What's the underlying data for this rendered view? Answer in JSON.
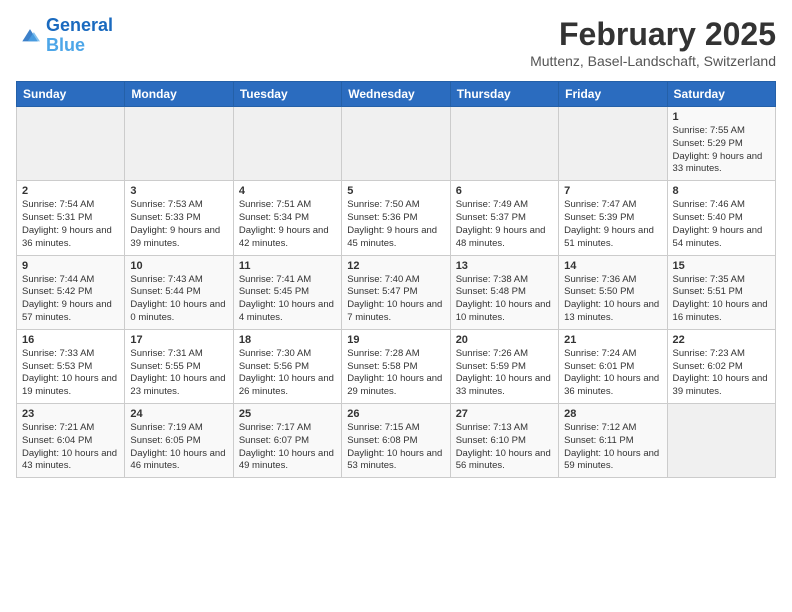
{
  "header": {
    "logo_line1": "General",
    "logo_line2": "Blue",
    "month_title": "February 2025",
    "location": "Muttenz, Basel-Landschaft, Switzerland"
  },
  "weekdays": [
    "Sunday",
    "Monday",
    "Tuesday",
    "Wednesday",
    "Thursday",
    "Friday",
    "Saturday"
  ],
  "weeks": [
    [
      {
        "day": "",
        "info": ""
      },
      {
        "day": "",
        "info": ""
      },
      {
        "day": "",
        "info": ""
      },
      {
        "day": "",
        "info": ""
      },
      {
        "day": "",
        "info": ""
      },
      {
        "day": "",
        "info": ""
      },
      {
        "day": "1",
        "info": "Sunrise: 7:55 AM\nSunset: 5:29 PM\nDaylight: 9 hours and 33 minutes."
      }
    ],
    [
      {
        "day": "2",
        "info": "Sunrise: 7:54 AM\nSunset: 5:31 PM\nDaylight: 9 hours and 36 minutes."
      },
      {
        "day": "3",
        "info": "Sunrise: 7:53 AM\nSunset: 5:33 PM\nDaylight: 9 hours and 39 minutes."
      },
      {
        "day": "4",
        "info": "Sunrise: 7:51 AM\nSunset: 5:34 PM\nDaylight: 9 hours and 42 minutes."
      },
      {
        "day": "5",
        "info": "Sunrise: 7:50 AM\nSunset: 5:36 PM\nDaylight: 9 hours and 45 minutes."
      },
      {
        "day": "6",
        "info": "Sunrise: 7:49 AM\nSunset: 5:37 PM\nDaylight: 9 hours and 48 minutes."
      },
      {
        "day": "7",
        "info": "Sunrise: 7:47 AM\nSunset: 5:39 PM\nDaylight: 9 hours and 51 minutes."
      },
      {
        "day": "8",
        "info": "Sunrise: 7:46 AM\nSunset: 5:40 PM\nDaylight: 9 hours and 54 minutes."
      }
    ],
    [
      {
        "day": "9",
        "info": "Sunrise: 7:44 AM\nSunset: 5:42 PM\nDaylight: 9 hours and 57 minutes."
      },
      {
        "day": "10",
        "info": "Sunrise: 7:43 AM\nSunset: 5:44 PM\nDaylight: 10 hours and 0 minutes."
      },
      {
        "day": "11",
        "info": "Sunrise: 7:41 AM\nSunset: 5:45 PM\nDaylight: 10 hours and 4 minutes."
      },
      {
        "day": "12",
        "info": "Sunrise: 7:40 AM\nSunset: 5:47 PM\nDaylight: 10 hours and 7 minutes."
      },
      {
        "day": "13",
        "info": "Sunrise: 7:38 AM\nSunset: 5:48 PM\nDaylight: 10 hours and 10 minutes."
      },
      {
        "day": "14",
        "info": "Sunrise: 7:36 AM\nSunset: 5:50 PM\nDaylight: 10 hours and 13 minutes."
      },
      {
        "day": "15",
        "info": "Sunrise: 7:35 AM\nSunset: 5:51 PM\nDaylight: 10 hours and 16 minutes."
      }
    ],
    [
      {
        "day": "16",
        "info": "Sunrise: 7:33 AM\nSunset: 5:53 PM\nDaylight: 10 hours and 19 minutes."
      },
      {
        "day": "17",
        "info": "Sunrise: 7:31 AM\nSunset: 5:55 PM\nDaylight: 10 hours and 23 minutes."
      },
      {
        "day": "18",
        "info": "Sunrise: 7:30 AM\nSunset: 5:56 PM\nDaylight: 10 hours and 26 minutes."
      },
      {
        "day": "19",
        "info": "Sunrise: 7:28 AM\nSunset: 5:58 PM\nDaylight: 10 hours and 29 minutes."
      },
      {
        "day": "20",
        "info": "Sunrise: 7:26 AM\nSunset: 5:59 PM\nDaylight: 10 hours and 33 minutes."
      },
      {
        "day": "21",
        "info": "Sunrise: 7:24 AM\nSunset: 6:01 PM\nDaylight: 10 hours and 36 minutes."
      },
      {
        "day": "22",
        "info": "Sunrise: 7:23 AM\nSunset: 6:02 PM\nDaylight: 10 hours and 39 minutes."
      }
    ],
    [
      {
        "day": "23",
        "info": "Sunrise: 7:21 AM\nSunset: 6:04 PM\nDaylight: 10 hours and 43 minutes."
      },
      {
        "day": "24",
        "info": "Sunrise: 7:19 AM\nSunset: 6:05 PM\nDaylight: 10 hours and 46 minutes."
      },
      {
        "day": "25",
        "info": "Sunrise: 7:17 AM\nSunset: 6:07 PM\nDaylight: 10 hours and 49 minutes."
      },
      {
        "day": "26",
        "info": "Sunrise: 7:15 AM\nSunset: 6:08 PM\nDaylight: 10 hours and 53 minutes."
      },
      {
        "day": "27",
        "info": "Sunrise: 7:13 AM\nSunset: 6:10 PM\nDaylight: 10 hours and 56 minutes."
      },
      {
        "day": "28",
        "info": "Sunrise: 7:12 AM\nSunset: 6:11 PM\nDaylight: 10 hours and 59 minutes."
      },
      {
        "day": "",
        "info": ""
      }
    ]
  ]
}
